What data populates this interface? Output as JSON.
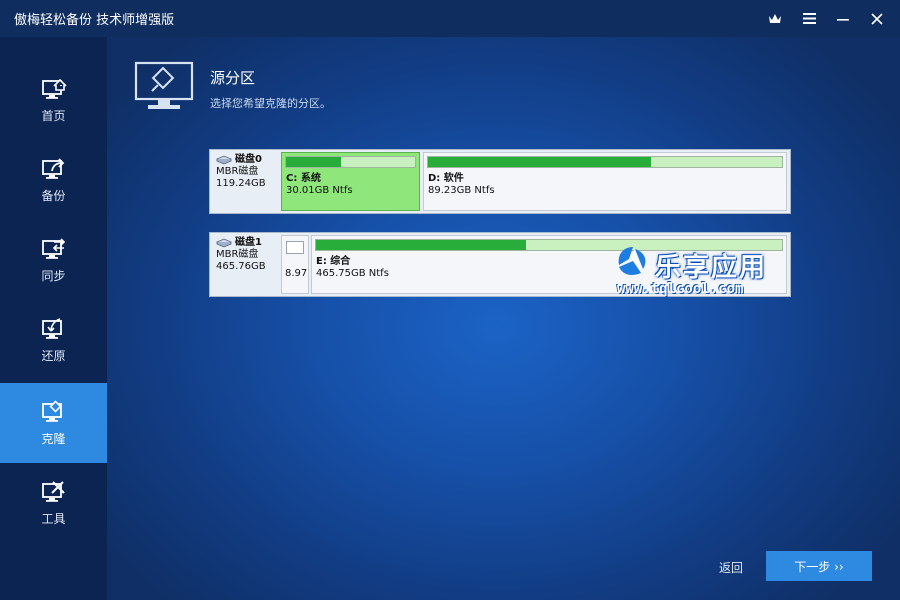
{
  "window": {
    "title": "傲梅轻松备份 技术师增强版",
    "controls": [
      "crown-icon",
      "menu-icon",
      "minimize-icon",
      "close-icon"
    ]
  },
  "sidebar": {
    "items": [
      {
        "label": "首页",
        "icon": "home-icon",
        "active": false
      },
      {
        "label": "备份",
        "icon": "backup-icon",
        "active": false
      },
      {
        "label": "同步",
        "icon": "sync-icon",
        "active": false
      },
      {
        "label": "还原",
        "icon": "restore-icon",
        "active": false
      },
      {
        "label": "克隆",
        "icon": "clone-icon",
        "active": true
      },
      {
        "label": "工具",
        "icon": "tools-icon",
        "active": false
      }
    ]
  },
  "header": {
    "title": "源分区",
    "subtitle": "选择您希望克隆的分区。"
  },
  "disks": [
    {
      "name": "磁盘0",
      "type": "MBR磁盘",
      "size": "119.24GB",
      "partitions": [
        {
          "label": "C: 系统",
          "size": "30.01GB Ntfs",
          "used_fraction": 0.43,
          "selected": true
        },
        {
          "label": "D: 软件",
          "size": "89.23GB Ntfs",
          "used_fraction": 0.63,
          "selected": false
        }
      ]
    },
    {
      "name": "磁盘1",
      "type": "MBR磁盘",
      "size": "465.76GB",
      "small_partition": {
        "size": "8.97"
      },
      "partitions": [
        {
          "label": "E: 综合",
          "size": "465.75GB Ntfs",
          "used_fraction": 0.45,
          "selected": false
        }
      ]
    }
  ],
  "watermark": {
    "text": "乐享应用",
    "url": "www.tqlcool.com"
  },
  "footer": {
    "back_label": "返回",
    "next_label": "下一步 ››"
  },
  "colors": {
    "accent": "#2d8ae0",
    "titlebar": "#0f2d5e",
    "sidebar": "#0c2451",
    "bar_fill": "#28ad3a",
    "selected_partition": "#8fe67a"
  }
}
